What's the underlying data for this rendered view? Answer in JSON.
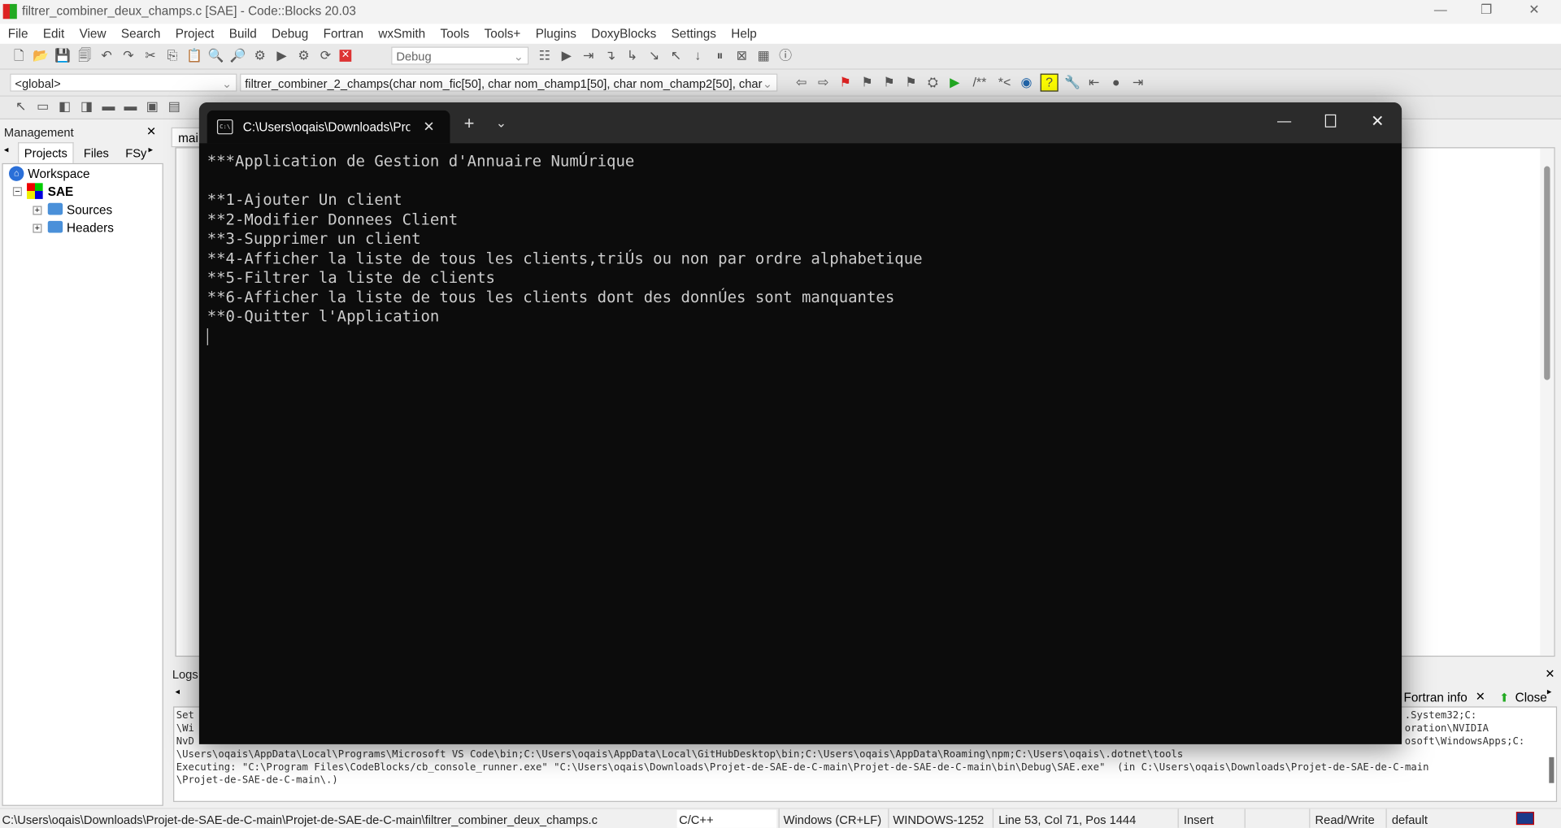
{
  "window": {
    "title": "filtrer_combiner_deux_champs.c [SAE] - Code::Blocks 20.03"
  },
  "menu": [
    "File",
    "Edit",
    "View",
    "Search",
    "Project",
    "Build",
    "Debug",
    "Fortran",
    "wxSmith",
    "Tools",
    "Tools+",
    "Plugins",
    "DoxyBlocks",
    "Settings",
    "Help"
  ],
  "toolbar": {
    "build_target": "Debug",
    "scope": "<global>",
    "function": "filtrer_combiner_2_champs(char nom_fic[50], char nom_champ1[50], char nom_champ2[50], char"
  },
  "management": {
    "title": "Management",
    "tabs": [
      "Projects",
      "Files",
      "FSy"
    ],
    "tree": {
      "workspace": "Workspace",
      "project": "SAE",
      "folders": [
        "Sources",
        "Headers"
      ]
    }
  },
  "editor": {
    "tab": "mai"
  },
  "logs": {
    "title": "Logs",
    "tabs": [
      "Fortran info",
      "Close"
    ],
    "lines": [
      "Set",
      "\\Wi",
      "NvD",
      "\\Users\\oqais\\AppData\\Local\\Programs\\Microsoft VS Code\\bin;C:\\Users\\oqais\\AppData\\Local\\GitHubDesktop\\bin;C:\\Users\\oqais\\AppData\\Roaming\\npm;C:\\Users\\oqais\\.dotnet\\tools",
      "Executing: \"C:\\Program Files\\CodeBlocks/cb_console_runner.exe\" \"C:\\Users\\oqais\\Downloads\\Projet-de-SAE-de-C-main\\Projet-de-SAE-de-C-main\\bin\\Debug\\SAE.exe\"  (in C:\\Users\\oqais\\Downloads\\Projet-de-SAE-de-C-main",
      "\\Projet-de-SAE-de-C-main\\.)"
    ],
    "right_fragments": [
      ".System32;C:",
      "oration\\NVIDIA",
      "osoft\\WindowsApps;C:"
    ]
  },
  "console": {
    "tab_title": "C:\\Users\\oqais\\Downloads\\Projet-de-SAE-de-C-main\\Projet-de-SAE-de-C-main\\bin\\Debug\\SAE.exe",
    "lines": [
      "***Application de Gestion d'Annuaire NumÚrique",
      "",
      "**1-Ajouter Un client",
      "**2-Modifier Donnees Client",
      "**3-Supprimer un client",
      "**4-Afficher la liste de tous les clients,triÚs ou non par ordre alphabetique",
      "**5-Filtrer la liste de clients",
      "**6-Afficher la liste de tous les clients dont des donnÚes sont manquantes",
      "**0-Quitter l'Application"
    ]
  },
  "status": {
    "path": "C:\\Users\\oqais\\Downloads\\Projet-de-SAE-de-C-main\\Projet-de-SAE-de-C-main\\filtrer_combiner_deux_champs.c",
    "language": "C/C++",
    "eol": "Windows (CR+LF)",
    "encoding": "WINDOWS-1252",
    "position": "Line 53, Col 71, Pos 1444",
    "mode": "Insert",
    "access": "Read/Write",
    "profile": "default"
  }
}
